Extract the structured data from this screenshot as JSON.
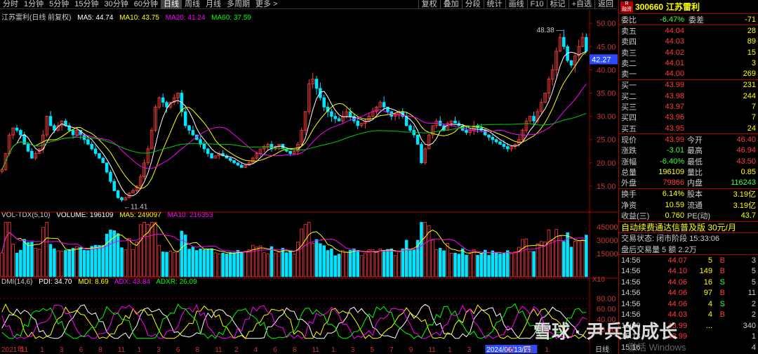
{
  "toolbar": {
    "left": [
      "分时",
      "1分钟",
      "5分钟",
      "15分钟",
      "30分钟",
      "60分钟",
      "日线",
      "周线",
      "月线",
      "多周期",
      "更多 >"
    ],
    "active": "日线",
    "right": [
      "复权",
      "叠加",
      "分段",
      "统计",
      "画线",
      "F10",
      "标记",
      "+自选",
      "返回"
    ]
  },
  "indicators": {
    "ma": {
      "name": "江苏雷利(日线 前复权)",
      "ma5": "MA5: 44.74",
      "ma10": "MA10: 43.75",
      "ma20": "MA20: 41.24",
      "ma60": "MA60: 37.59"
    },
    "vol": {
      "name": "VOL-TDX(5,10)",
      "volume": "VOLUME: 196109",
      "ma5": "MA5: 249097",
      "ma10": "MA10: 216353"
    },
    "dmi": {
      "name": "DMI(14,6)",
      "pdi": "PDI: 34.70",
      "mdi": "MDI: 8.69",
      "adx": "ADX: 43.84",
      "adxr": "ADXR: 26.09"
    }
  },
  "labels": {
    "high": "48.38",
    "low": "11.41",
    "cur": "42.27",
    "vol_unit": "X10",
    "date_marker": "2024/06/13/四",
    "time_right": "日线"
  },
  "chart_data": [
    {
      "type": "candlestick",
      "title": "江苏雷利(日线 前复权)",
      "y_ticks": [
        15,
        20,
        25,
        30,
        35,
        40,
        45,
        50
      ],
      "ylim": [
        10,
        52
      ],
      "x_labels": [
        "2021年",
        "11",
        "1",
        "3",
        "6",
        "8",
        "11",
        "1",
        "3",
        "6",
        "8",
        "11",
        "2",
        "4",
        "6",
        "8",
        "11",
        "1",
        "3",
        "5",
        "7",
        "9",
        "11",
        "1",
        "3",
        "2024/06/13/四",
        "10",
        "12",
        "1"
      ],
      "closes": [
        18.5,
        22,
        26,
        27.5,
        27,
        26,
        24,
        22.5,
        21,
        22,
        23,
        26,
        30,
        28,
        27,
        28,
        29,
        28,
        27,
        26,
        27,
        26,
        25,
        24,
        23,
        22,
        21,
        20,
        18,
        16,
        14,
        12.5,
        12,
        12.5,
        13.5,
        14,
        15,
        17,
        20,
        23,
        27,
        32,
        34,
        33,
        32,
        33,
        34,
        35,
        31,
        28,
        27,
        26,
        25,
        24,
        23,
        22,
        21,
        21.5,
        22,
        21.5,
        21,
        20.5,
        20,
        19.5,
        19,
        19.5,
        20,
        21,
        22,
        23,
        23.5,
        24,
        23,
        23.5,
        24,
        23,
        22.5,
        22,
        22.5,
        24,
        27,
        31,
        37,
        38,
        36,
        34,
        32,
        31,
        30,
        29.5,
        29,
        30,
        31,
        30,
        29,
        28,
        28.5,
        29,
        30,
        31,
        32,
        33,
        32,
        31,
        30,
        30.5,
        31,
        30,
        28,
        27,
        26,
        24,
        20,
        23,
        26,
        28,
        29,
        28,
        27,
        28.5,
        29,
        28.5,
        28,
        27,
        26.5,
        27,
        28,
        27.5,
        27,
        26,
        25.5,
        25,
        24.5,
        24,
        23.5,
        23,
        23.5,
        24,
        25,
        27,
        29,
        30,
        29,
        31,
        33,
        35,
        38,
        40,
        44,
        47,
        45,
        42,
        41,
        43,
        45,
        47,
        44
      ]
    },
    {
      "type": "bar",
      "title": "VOL-TDX(5,10)",
      "y_ticks": [
        15000,
        30000,
        45000
      ],
      "ylim": [
        0,
        52000
      ],
      "y_unit": "X10"
    },
    {
      "type": "line",
      "title": "DMI(14,6)",
      "y_ticks": [
        20,
        40,
        60,
        80
      ],
      "ylim": [
        0,
        100
      ],
      "series": [
        {
          "name": "PDI",
          "color": "#ffffff"
        },
        {
          "name": "MDI",
          "color": "#ffff00"
        },
        {
          "name": "ADX",
          "color": "#ff00ff"
        },
        {
          "name": "ADXR",
          "color": "#00ff00"
        }
      ]
    }
  ],
  "quote": {
    "code": "300660",
    "name": "江苏雷利",
    "badge": "R\n融资",
    "weibi_label": "委比",
    "weibi": "-6.47%",
    "weicha_label": "委差",
    "weicha": "-71",
    "asks": [
      {
        "l": "卖五",
        "p": "44.04",
        "v": "28"
      },
      {
        "l": "卖四",
        "p": "44.03",
        "v": "89"
      },
      {
        "l": "卖三",
        "p": "44.02",
        "v": "15"
      },
      {
        "l": "卖二",
        "p": "44.01",
        "v": "3"
      },
      {
        "l": "卖一",
        "p": "44.00",
        "v": "269"
      }
    ],
    "bids": [
      {
        "l": "买一",
        "p": "43.99",
        "v": "231"
      },
      {
        "l": "买二",
        "p": "43.98",
        "v": "244"
      },
      {
        "l": "买三",
        "p": "43.97",
        "v": "7"
      },
      {
        "l": "买四",
        "p": "43.96",
        "v": "7"
      },
      {
        "l": "买五",
        "p": "43.95",
        "v": "24"
      }
    ],
    "stats": [
      {
        "a": "现价",
        "b": "43.99",
        "bc": "red",
        "c": "今开",
        "d": "46.40",
        "dc": "red"
      },
      {
        "a": "涨跌",
        "b": "-3.01",
        "bc": "grn",
        "c": "最高",
        "d": "46.94",
        "dc": "red"
      },
      {
        "a": "涨幅",
        "b": "-6.40%",
        "bc": "grn",
        "c": "最低",
        "d": "43.50",
        "dc": "red"
      },
      {
        "a": "总量",
        "b": "196109",
        "bc": "yel",
        "c": "量比",
        "d": "0.85",
        "dc": "yel"
      },
      {
        "a": "外盘",
        "b": "79866",
        "bc": "red",
        "c": "内盘",
        "d": "116243",
        "dc": "grn"
      }
    ],
    "stats2": [
      {
        "a": "换手",
        "b": "6.14%",
        "bc": "yel",
        "c": "股本",
        "d": "3.19亿",
        "dc": "yel"
      },
      {
        "a": "净资",
        "b": "10.59",
        "bc": "yel",
        "c": "流通",
        "d": "3.19亿",
        "dc": "yel"
      },
      {
        "a": "收益(三)",
        "b": "0.760",
        "bc": "yel",
        "c": "PE(动)",
        "d": "43.7",
        "dc": "yel"
      }
    ],
    "ad": "自动续费通达信普及版 30元/月",
    "trade_status": "交易状态: 闭市阶段 15:33:06",
    "after_hours": "盘后交易量 5 额 2.2万",
    "trades": [
      {
        "t": "14:56",
        "p": "44.07",
        "n": "5",
        "s": "B",
        "k": "3"
      },
      {
        "t": "14:56",
        "p": "44.10",
        "n": "149",
        "s": "B",
        "k": "5"
      },
      {
        "t": "14:56",
        "p": "44.06",
        "n": "16",
        "s": "S",
        "k": "5"
      },
      {
        "t": "14:56",
        "p": "44.06",
        "n": "97",
        "s": "B",
        "k": "11"
      },
      {
        "t": "14:56",
        "p": "44.06",
        "n": "4",
        "s": "S",
        "k": "2"
      },
      {
        "t": "14:56",
        "p": "44.03",
        "n": "4",
        "s": "B",
        "k": "2"
      },
      {
        "t": "15:00",
        "p": "43.99",
        "n": "...",
        "s": "",
        "k": "340"
      },
      {
        "t": "15:13",
        "p": "43.99",
        "n": "",
        "s": "",
        "k": "1"
      },
      {
        "t": "15:16",
        "p": "",
        "n": "",
        "s": "",
        "k": "4"
      }
    ]
  },
  "watermark": "雪球 · 尹兵的成长",
  "win": "激活 Windows"
}
